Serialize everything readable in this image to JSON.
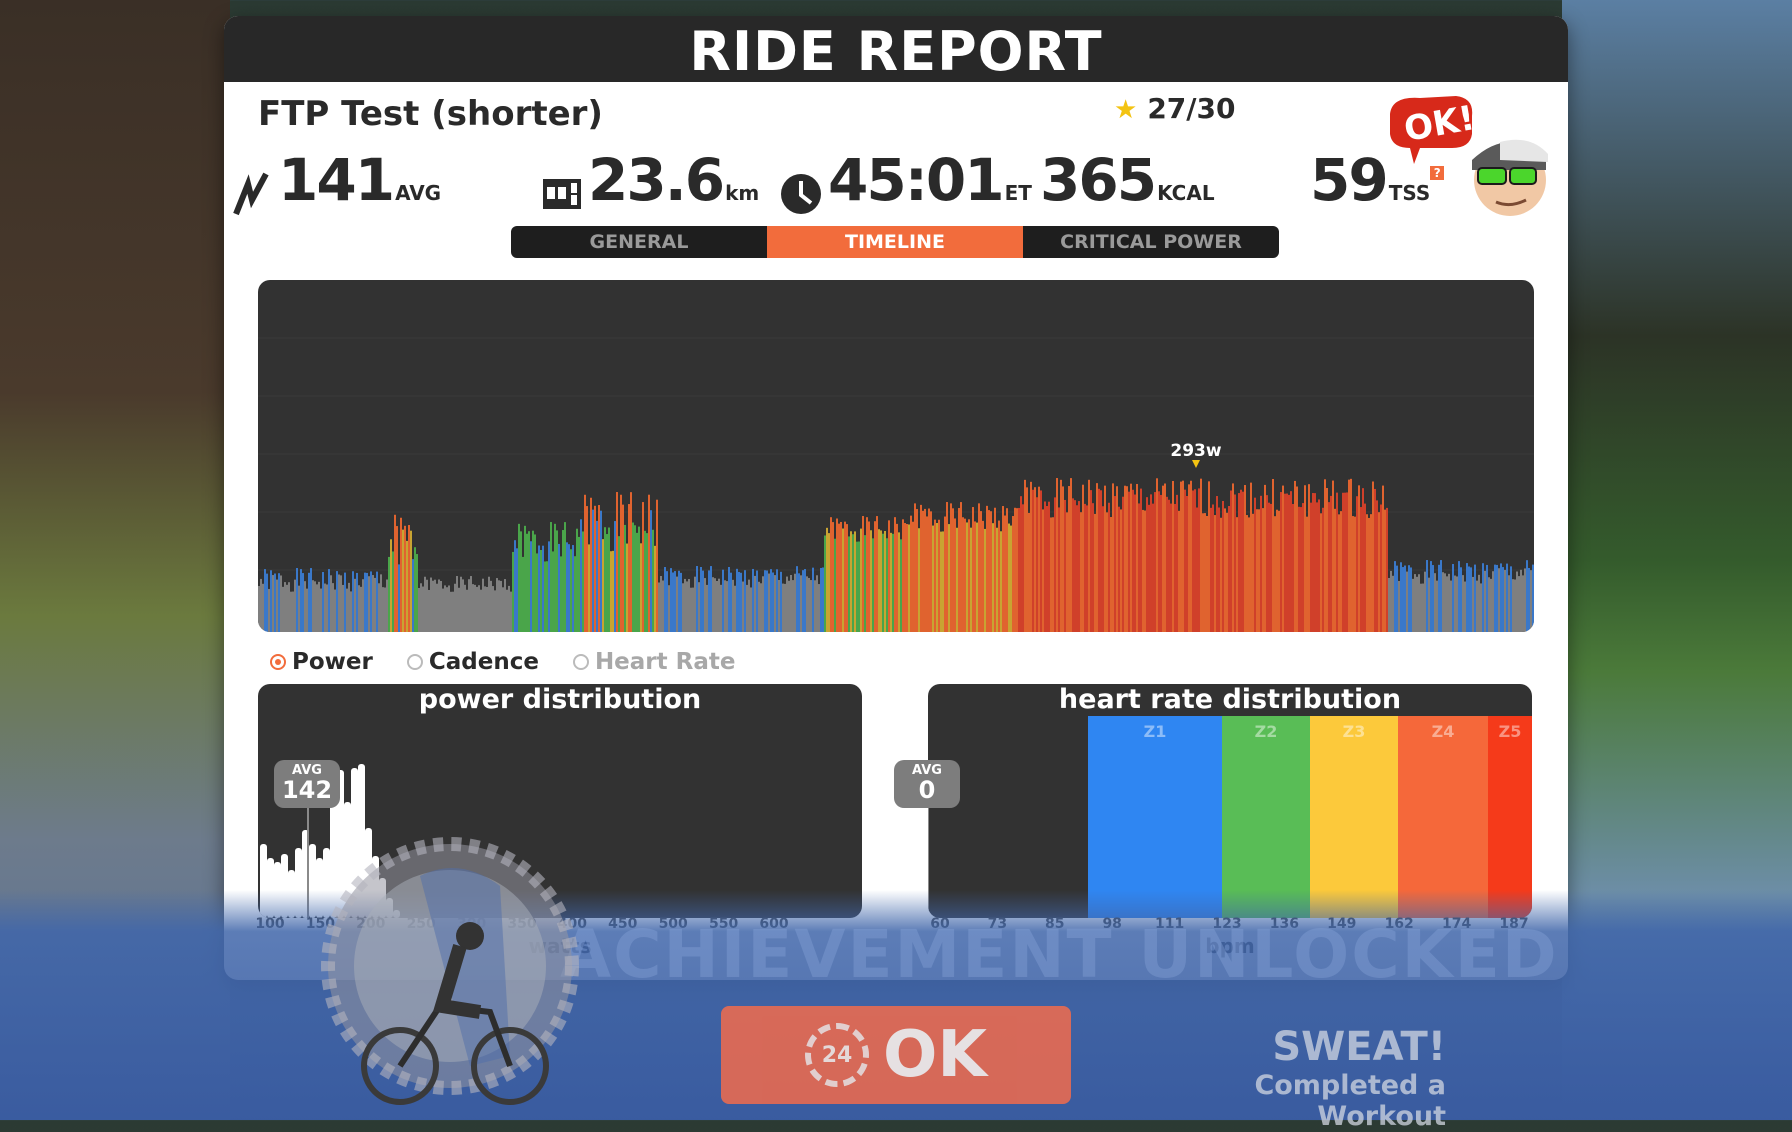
{
  "report": {
    "title": "RIDE REPORT",
    "workout_name": "FTP Test (shorter)",
    "star_score": "27/30"
  },
  "stats": {
    "power": {
      "value": "141",
      "unit": "AVG",
      "icon": "power-bolt-icon"
    },
    "distance": {
      "value": "23.6",
      "unit": "km",
      "icon": "odometer-icon"
    },
    "time": {
      "value": "45:01",
      "unit": "ET",
      "icon": "clock-icon"
    },
    "calories": {
      "value": "365",
      "unit": "KCAL"
    },
    "tss": {
      "value": "59",
      "unit": "TSS",
      "help": "?"
    }
  },
  "badge": {
    "text": "OK!"
  },
  "tabs": [
    {
      "label": "GENERAL",
      "active": false
    },
    {
      "label": "TIMELINE",
      "active": true
    },
    {
      "label": "CRITICAL POWER",
      "active": false
    }
  ],
  "timeline": {
    "peak_label": "293w",
    "zone_colors": {
      "gray": "#7f7f7f",
      "blue": "#3a78c9",
      "green": "#4aa54a",
      "yellow": "#c8a432",
      "orange": "#e0632f",
      "red": "#d0402a"
    }
  },
  "legend": [
    {
      "label": "Power",
      "selected": true
    },
    {
      "label": "Cadence",
      "selected": false
    },
    {
      "label": "Heart Rate",
      "selected": false
    }
  ],
  "power_distribution": {
    "title": "power distribution",
    "avg_label": "AVG",
    "avg_value": "142",
    "ticks": [
      "100",
      "150",
      "200",
      "250",
      "300",
      "350",
      "400",
      "450",
      "500",
      "550",
      "600"
    ],
    "axis_label": "watts"
  },
  "hr_distribution": {
    "title": "heart rate distribution",
    "avg_label": "AVG",
    "avg_value": "0",
    "ticks": [
      "60",
      "73",
      "85",
      "98",
      "111",
      "123",
      "136",
      "149",
      "162",
      "174",
      "187"
    ],
    "axis_label": "bpm",
    "zones": [
      {
        "label": "Z1",
        "color": "#2f86f2"
      },
      {
        "label": "Z2",
        "color": "#59bd56"
      },
      {
        "label": "Z3",
        "color": "#fcc93b"
      },
      {
        "label": "Z4",
        "color": "#f5683a"
      },
      {
        "label": "Z5",
        "color": "#f53a1a"
      }
    ]
  },
  "achievement": {
    "banner_text": "ACHIEVEMENT UNLOCKED",
    "name": "SWEAT!",
    "description": "Completed a Workout"
  },
  "ok_button": {
    "countdown": "24",
    "label": "OK"
  }
}
